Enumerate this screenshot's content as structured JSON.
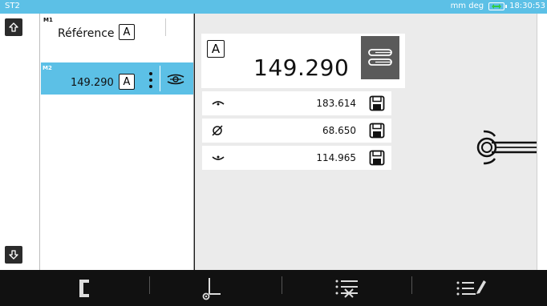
{
  "header": {
    "title": "ST2",
    "units": "mm deg",
    "time": "18:30:53"
  },
  "list": {
    "items": [
      {
        "tag": "M1",
        "label": "Référence",
        "axis": "A"
      },
      {
        "tag": "M2",
        "label": "149.290",
        "axis": "A"
      }
    ]
  },
  "main": {
    "axis": "A",
    "value": "149.290",
    "measurements": [
      {
        "icon": "top-arc-icon",
        "value": "183.614"
      },
      {
        "icon": "diameter-icon",
        "value": "68.650"
      },
      {
        "icon": "bottom-arc-icon",
        "value": "114.965"
      }
    ]
  },
  "colors": {
    "accent": "#5cc0e6",
    "toolbar": "#111111",
    "panel": "#ebebeb"
  },
  "icons": {
    "nav_up": "arrow-up-icon",
    "nav_down": "arrow-down-icon",
    "pin": "pin-gauge-icon",
    "save": "save-icon",
    "bottom": [
      "bracket-icon",
      "probe-icon",
      "list-delete-icon",
      "list-edit-icon"
    ]
  }
}
